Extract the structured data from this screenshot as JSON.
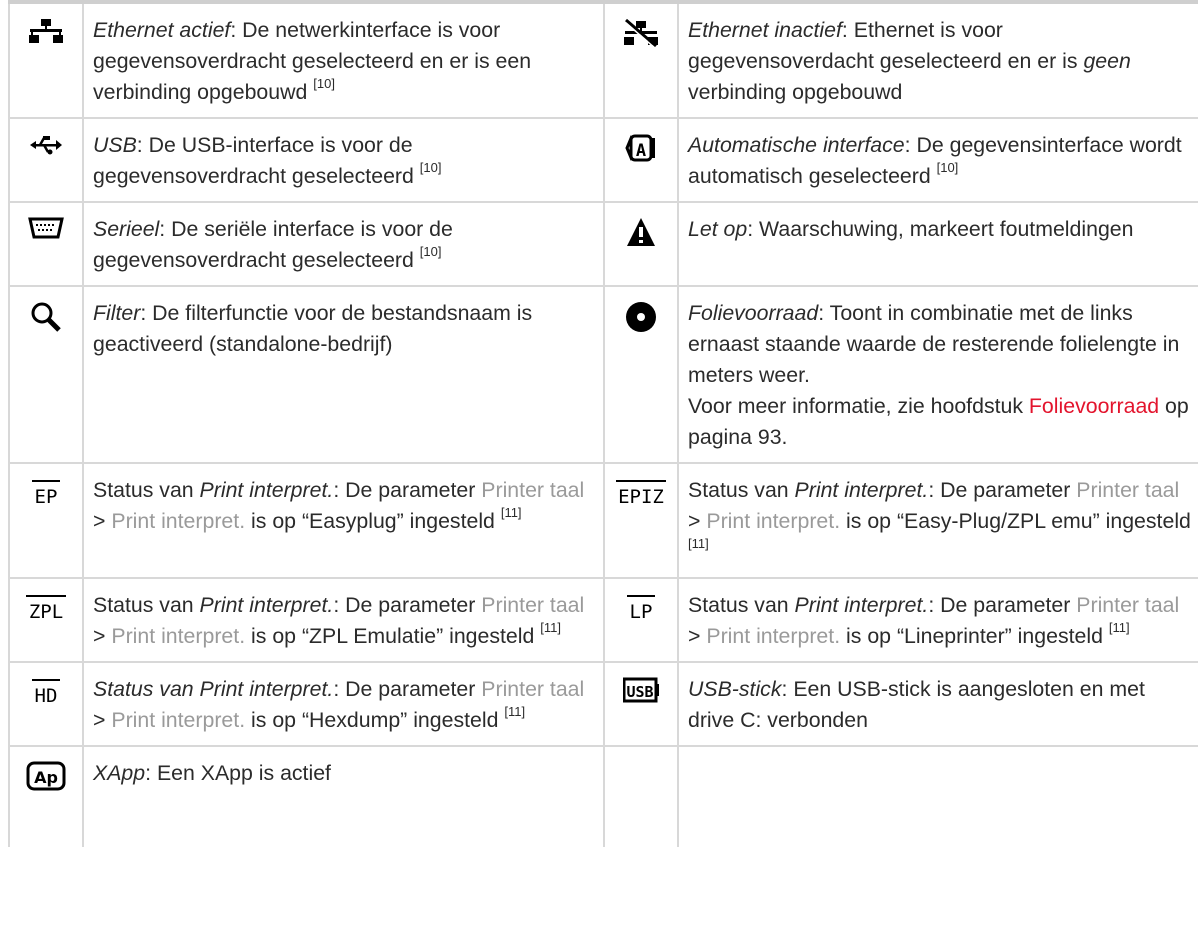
{
  "rows": [
    {
      "left": {
        "icon": "ethernet-active-icon",
        "parts": [
          {
            "text": "Ethernet actief",
            "style": "italic"
          },
          {
            "text": ": De netwerkinterface is voor gegevensoverdracht geselecteerd en er is een verbinding opgebouwd "
          },
          {
            "text": "[10]",
            "style": "sup"
          }
        ]
      },
      "right": {
        "icon": "ethernet-inactive-icon",
        "parts": [
          {
            "text": "Ethernet inactief",
            "style": "italic"
          },
          {
            "text": ": Ethernet is voor gegevensoverdacht geselecteerd en er is "
          },
          {
            "text": "geen",
            "style": "italic"
          },
          {
            "text": " verbinding opgebouwd"
          }
        ]
      }
    },
    {
      "left": {
        "icon": "usb-icon",
        "parts": [
          {
            "text": "USB",
            "style": "italic"
          },
          {
            "text": ": De USB-interface is voor de gegevensoverdracht geselecteerd "
          },
          {
            "text": "[10]",
            "style": "sup"
          }
        ]
      },
      "right": {
        "icon": "automatic-interface-icon",
        "parts": [
          {
            "text": "Automatische interface",
            "style": "italic"
          },
          {
            "text": ": De gegevensinterface wordt automatisch geselecteerd "
          },
          {
            "text": "[10]",
            "style": "sup"
          }
        ]
      }
    },
    {
      "left": {
        "icon": "serial-port-icon",
        "parts": [
          {
            "text": "Serieel",
            "style": "italic"
          },
          {
            "text": ": De seriële interface is voor de gegevensoverdracht geselecteerd "
          },
          {
            "text": "[10]",
            "style": "sup"
          }
        ]
      },
      "right": {
        "icon": "warning-icon",
        "parts": [
          {
            "text": "Let op",
            "style": "italic"
          },
          {
            "text": ": Waarschuwing, markeert foutmeldingen"
          }
        ]
      }
    },
    {
      "left": {
        "icon": "filter-magnifier-icon",
        "parts": [
          {
            "text": "Filter",
            "style": "italic"
          },
          {
            "text": ": De filterfunctie voor de bestandsnaam is geactiveerd (standalone-bedrijf)"
          }
        ]
      },
      "right": {
        "icon": "foil-supply-icon",
        "parts": [
          {
            "text": "Folievoorraad",
            "style": "italic"
          },
          {
            "text": ": Toont in combinatie met de links ernaast staande waarde de resterende folielengte in meters weer."
          },
          {
            "text": "",
            "style": "br"
          },
          {
            "text": "Voor meer informatie, zie hoofdstuk "
          },
          {
            "text": "Folievoorraad",
            "style": "red"
          },
          {
            "text": " op pagina 93."
          }
        ]
      }
    },
    {
      "left": {
        "icon": "ep-status-icon",
        "parts": [
          {
            "text": "Status van "
          },
          {
            "text": "Print interpret.",
            "style": "italic"
          },
          {
            "text": ": De parameter "
          },
          {
            "text": "Printer taal",
            "style": "gray"
          },
          {
            "text": " > "
          },
          {
            "text": "Print interpret.",
            "style": "gray"
          },
          {
            "text": " is op “Easyplug” ingesteld "
          },
          {
            "text": "[11]",
            "style": "sup"
          }
        ]
      },
      "right": {
        "icon": "epiz-status-icon",
        "parts": [
          {
            "text": "Status van "
          },
          {
            "text": "Print interpret.",
            "style": "italic"
          },
          {
            "text": ": De parameter "
          },
          {
            "text": "Printer taal",
            "style": "gray"
          },
          {
            "text": " > "
          },
          {
            "text": "Print interpret.",
            "style": "gray"
          },
          {
            "text": " is op “Easy-Plug/ZPL emu” ingesteld "
          },
          {
            "text": "[11]",
            "style": "sup"
          }
        ]
      }
    },
    {
      "left": {
        "icon": "zpl-status-icon",
        "parts": [
          {
            "text": "Status van "
          },
          {
            "text": "Print interpret.",
            "style": "italic"
          },
          {
            "text": ": De parameter "
          },
          {
            "text": "Printer taal",
            "style": "gray"
          },
          {
            "text": " > "
          },
          {
            "text": "Print interpret.",
            "style": "gray"
          },
          {
            "text": " is op “ZPL Emulatie” ingesteld "
          },
          {
            "text": "[11]",
            "style": "sup"
          }
        ]
      },
      "right": {
        "icon": "lp-status-icon",
        "parts": [
          {
            "text": "Status van "
          },
          {
            "text": "Print interpret.",
            "style": "italic"
          },
          {
            "text": ": De parameter "
          },
          {
            "text": "Printer taal",
            "style": "gray"
          },
          {
            "text": " > "
          },
          {
            "text": "Print interpret.",
            "style": "gray"
          },
          {
            "text": " is op “Lineprinter” ingesteld "
          },
          {
            "text": "[11]",
            "style": "sup"
          }
        ]
      }
    },
    {
      "left": {
        "icon": "hd-status-icon",
        "parts": [
          {
            "text": "Status van Print interpret.",
            "style": "italic"
          },
          {
            "text": ": De parameter "
          },
          {
            "text": "Printer taal",
            "style": "gray"
          },
          {
            "text": " > "
          },
          {
            "text": "Print interpret.",
            "style": "gray"
          },
          {
            "text": " is op “Hexdump” ingesteld "
          },
          {
            "text": "[11]",
            "style": "sup"
          }
        ]
      },
      "right": {
        "icon": "usb-stick-icon",
        "parts": [
          {
            "text": "USB-stick",
            "style": "italic"
          },
          {
            "text": ": Een USB-stick is aangesloten en met drive C: verbonden"
          }
        ]
      }
    },
    {
      "left": {
        "icon": "xapp-icon",
        "parts": [
          {
            "text": "XApp",
            "style": "italic"
          },
          {
            "text": ": Een XApp is actief"
          }
        ]
      },
      "right": null
    }
  ]
}
